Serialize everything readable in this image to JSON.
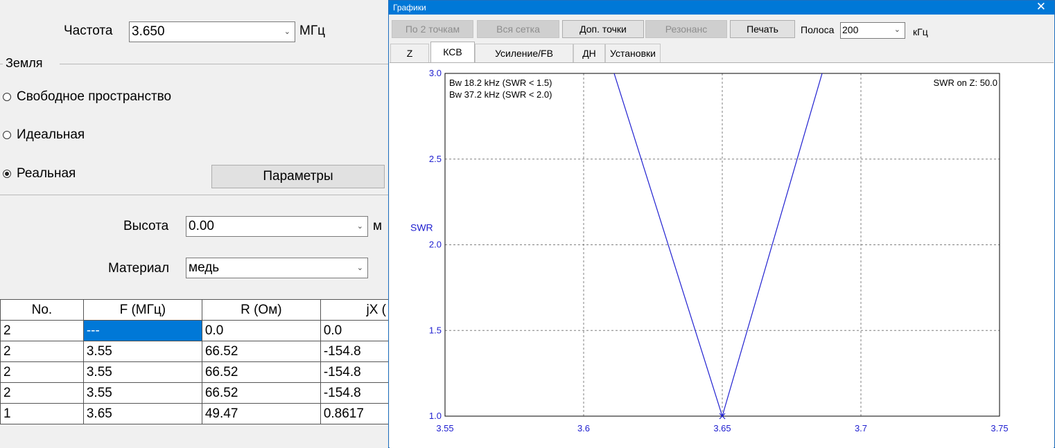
{
  "left": {
    "freq_label": "Частота",
    "freq_value": "3.650",
    "freq_unit": "МГц",
    "ground_group": "Земля",
    "radio_free": "Свободное пространство",
    "radio_ideal": "Идеальная",
    "radio_real": "Реальная",
    "radio_selected": "real",
    "params_button": "Параметры",
    "height_label": "Высота",
    "height_value": "0.00",
    "height_unit": "м",
    "material_label": "Материал",
    "material_value": "медь",
    "table": {
      "headers": [
        "No.",
        "F (МГц)",
        "R (Ом)",
        "jX ("
      ],
      "rows": [
        [
          "2",
          "---",
          "0.0",
          "0.0"
        ],
        [
          "2",
          "3.55",
          "66.52",
          "-154.8"
        ],
        [
          "2",
          "3.55",
          "66.52",
          "-154.8"
        ],
        [
          "2",
          "3.55",
          "66.52",
          "-154.8"
        ],
        [
          "1",
          "3.65",
          "49.47",
          "0.8617"
        ]
      ]
    }
  },
  "graph_window": {
    "title": "Графики",
    "close_glyph": "✕",
    "toolbar": {
      "by2points": "По 2 точкам",
      "full_grid": "Вся сетка",
      "extra_points": "Доп. точки",
      "resonance": "Резонанс",
      "print": "Печать",
      "band_label": "Полоса",
      "band_value": "200",
      "band_unit": "кГц"
    },
    "tabs": [
      "Z",
      "КСВ",
      "Усиление/FB",
      "ДН",
      "Установки"
    ],
    "active_tab": "КСВ"
  },
  "chart_data": {
    "type": "line",
    "ylabel": "SWR",
    "xlim": [
      3.55,
      3.75
    ],
    "ylim": [
      1.0,
      3.0
    ],
    "xticks": [
      "3.55",
      "3.6",
      "3.65",
      "3.7",
      "3.75"
    ],
    "yticks": [
      "1.0",
      "1.5",
      "2.0",
      "2.5",
      "3.0"
    ],
    "grid": true,
    "annotations": {
      "bw1": "Bw 18.2 kHz (SWR < 1.5)",
      "bw2": "Bw 37.2 kHz (SWR < 2.0)",
      "swr_on_z": "SWR on Z: 50.0"
    },
    "series": [
      {
        "color": "#2020d0",
        "x": [
          3.611,
          3.65,
          3.686
        ],
        "y": [
          3.0,
          1.0,
          3.0
        ]
      }
    ],
    "marker": {
      "x": 3.65,
      "y": 1.0
    },
    "colors": {
      "line": "#2020d0",
      "axis_text": "#2020d0",
      "grid": "#7f7f7f"
    }
  }
}
